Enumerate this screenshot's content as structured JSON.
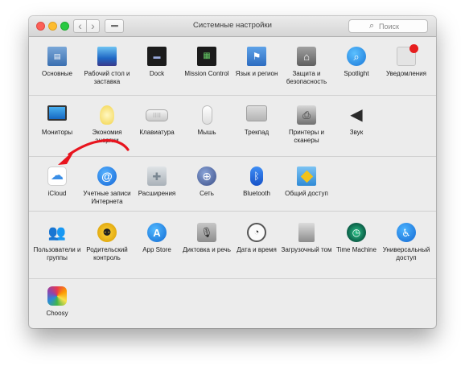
{
  "window": {
    "title": "Системные настройки",
    "search_placeholder": "Поиск"
  },
  "sections": [
    [
      {
        "name": "osnovnye",
        "label": "Основные",
        "icon": "file-icon"
      },
      {
        "name": "desktop",
        "label": "Рабочий стол и заставка",
        "icon": "desktop-icon"
      },
      {
        "name": "dock",
        "label": "Dock",
        "icon": "dock-icon"
      },
      {
        "name": "mission-control",
        "label": "Mission Control",
        "icon": "mission-control-icon"
      },
      {
        "name": "language",
        "label": "Язык и регион",
        "icon": "flag-icon"
      },
      {
        "name": "security",
        "label": "Защита и безопасность",
        "icon": "house-icon"
      },
      {
        "name": "spotlight",
        "label": "Spotlight",
        "icon": "magnifier-icon"
      },
      {
        "name": "notifications",
        "label": "Уведомления",
        "icon": "notification-icon"
      }
    ],
    [
      {
        "name": "displays",
        "label": "Мониторы",
        "icon": "monitor-icon"
      },
      {
        "name": "energy",
        "label": "Экономия энергии",
        "icon": "bulb-icon"
      },
      {
        "name": "keyboard",
        "label": "Клавиатура",
        "icon": "keyboard-icon"
      },
      {
        "name": "mouse",
        "label": "Мышь",
        "icon": "mouse-icon"
      },
      {
        "name": "trackpad",
        "label": "Трекпад",
        "icon": "trackpad-icon"
      },
      {
        "name": "printers",
        "label": "Принтеры и сканеры",
        "icon": "printer-icon"
      },
      {
        "name": "sound",
        "label": "Звук",
        "icon": "speaker-icon"
      }
    ],
    [
      {
        "name": "icloud",
        "label": "iCloud",
        "icon": "cloud-icon"
      },
      {
        "name": "internet-accounts",
        "label": "Учетные записи Интернета",
        "icon": "at-icon"
      },
      {
        "name": "extensions",
        "label": "Расширения",
        "icon": "puzzle-icon"
      },
      {
        "name": "network",
        "label": "Сеть",
        "icon": "globe-icon"
      },
      {
        "name": "bluetooth",
        "label": "Bluetooth",
        "icon": "bluetooth-icon"
      },
      {
        "name": "sharing",
        "label": "Общий доступ",
        "icon": "sharing-icon"
      }
    ],
    [
      {
        "name": "users",
        "label": "Пользователи и группы",
        "icon": "users-icon"
      },
      {
        "name": "parental",
        "label": "Родительский контроль",
        "icon": "parental-icon"
      },
      {
        "name": "app-store",
        "label": "App Store",
        "icon": "app-store-icon"
      },
      {
        "name": "dictation",
        "label": "Диктовка и речь",
        "icon": "microphone-icon"
      },
      {
        "name": "date-time",
        "label": "Дата и время",
        "icon": "clock-icon"
      },
      {
        "name": "startup-disk",
        "label": "Загрузочный том",
        "icon": "disk-icon"
      },
      {
        "name": "time-machine",
        "label": "Time Machine",
        "icon": "time-machine-icon"
      },
      {
        "name": "accessibility",
        "label": "Универсальный доступ",
        "icon": "accessibility-icon"
      }
    ],
    [
      {
        "name": "choosy",
        "label": "Choosy",
        "icon": "choosy-icon"
      }
    ]
  ]
}
